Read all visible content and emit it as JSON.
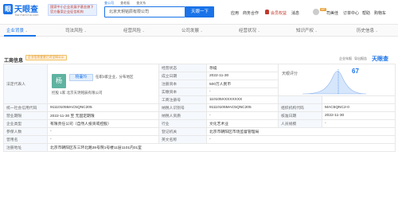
{
  "header": {
    "logo_text": "天眼查",
    "logo_sub": "TianYanCha.com",
    "banner_line1": "国家中小企业发展子基金旗下",
    "banner_line2": "官方备案企业征信机构",
    "search_tabs": [
      "查公司",
      "查老板",
      "查关系"
    ],
    "search_value": "北京天玥铭辰有限公司",
    "search_button": "天眼一下",
    "nav": [
      "应用",
      "商务合作",
      "会员权益",
      "消息",
      "司美佳",
      "订单中心",
      "帮助",
      "购物车"
    ],
    "vip_badge": "VIP"
  },
  "tabs": [
    "企业背景",
    "司法风险",
    "经营风险",
    "公司发展",
    "经营状况",
    "知识产权",
    "历史信息"
  ],
  "section": {
    "title": "工商信息",
    "badge": "企业信息变更已对全网公示",
    "tools": [
      "企业年报",
      "导出报告"
    ],
    "logo": "天眼查"
  },
  "legal": {
    "label": "法定代表人",
    "avatar_char": "杨",
    "name": "杨蔓玲",
    "extra": "任职3家企业，分布地区",
    "relations": "控股 1家    北京天玥铭辰有限公司"
  },
  "score": {
    "label": "天眼评分",
    "value": "67",
    "side": "报告",
    "chart_color": "#1a73e8"
  },
  "rows": [
    {
      "l1": "经营状态",
      "v1": "存续",
      "l2": "曾用名",
      "v2": "-"
    },
    {
      "l1": "成立日期",
      "v1": "2022-11-30",
      "l2": "",
      "v2": ""
    },
    {
      "l1": "注册资本",
      "v1": "500万人民币",
      "l2": "",
      "v2": ""
    },
    {
      "l1": "实缴资本",
      "v1": "-",
      "l2": "",
      "v2": ""
    },
    {
      "l1": "工商注册号",
      "v1": "110105XXXXXXXX",
      "l2": "",
      "v2": ""
    }
  ],
  "details": [
    {
      "a": "统一社会信用代码",
      "b": "91110105MAC5QNC205",
      "c": "纳税人识别号",
      "d": "91110105MAC5QNC205",
      "e": "组织机构代码",
      "f": "MAC5QNC2-0"
    },
    {
      "a": "营业期限",
      "b": "2022-11-30 至 无固定期限",
      "c": "纳税人资质",
      "d": "-",
      "e": "核准日期",
      "f": "2022-11-30"
    },
    {
      "a": "企业类型",
      "b": "有限责任公司（自然人投资或控股）",
      "c": "行业",
      "d": "文化艺术业",
      "e": "人员规模",
      "f": "-"
    },
    {
      "a": "参保人数",
      "b": "-",
      "c": "登记机关",
      "d": "北京市朝阳区市场监督管理局",
      "e": "",
      "f": ""
    },
    {
      "a": "曾用名",
      "b": "-",
      "c": "英文名称",
      "d": "-",
      "e": "",
      "f": ""
    },
    {
      "a": "注册地址",
      "b": "北京市朝阳区东三环北路38号院1号楼11层1101内01室",
      "c": "",
      "d": "",
      "e": "",
      "f": ""
    }
  ]
}
